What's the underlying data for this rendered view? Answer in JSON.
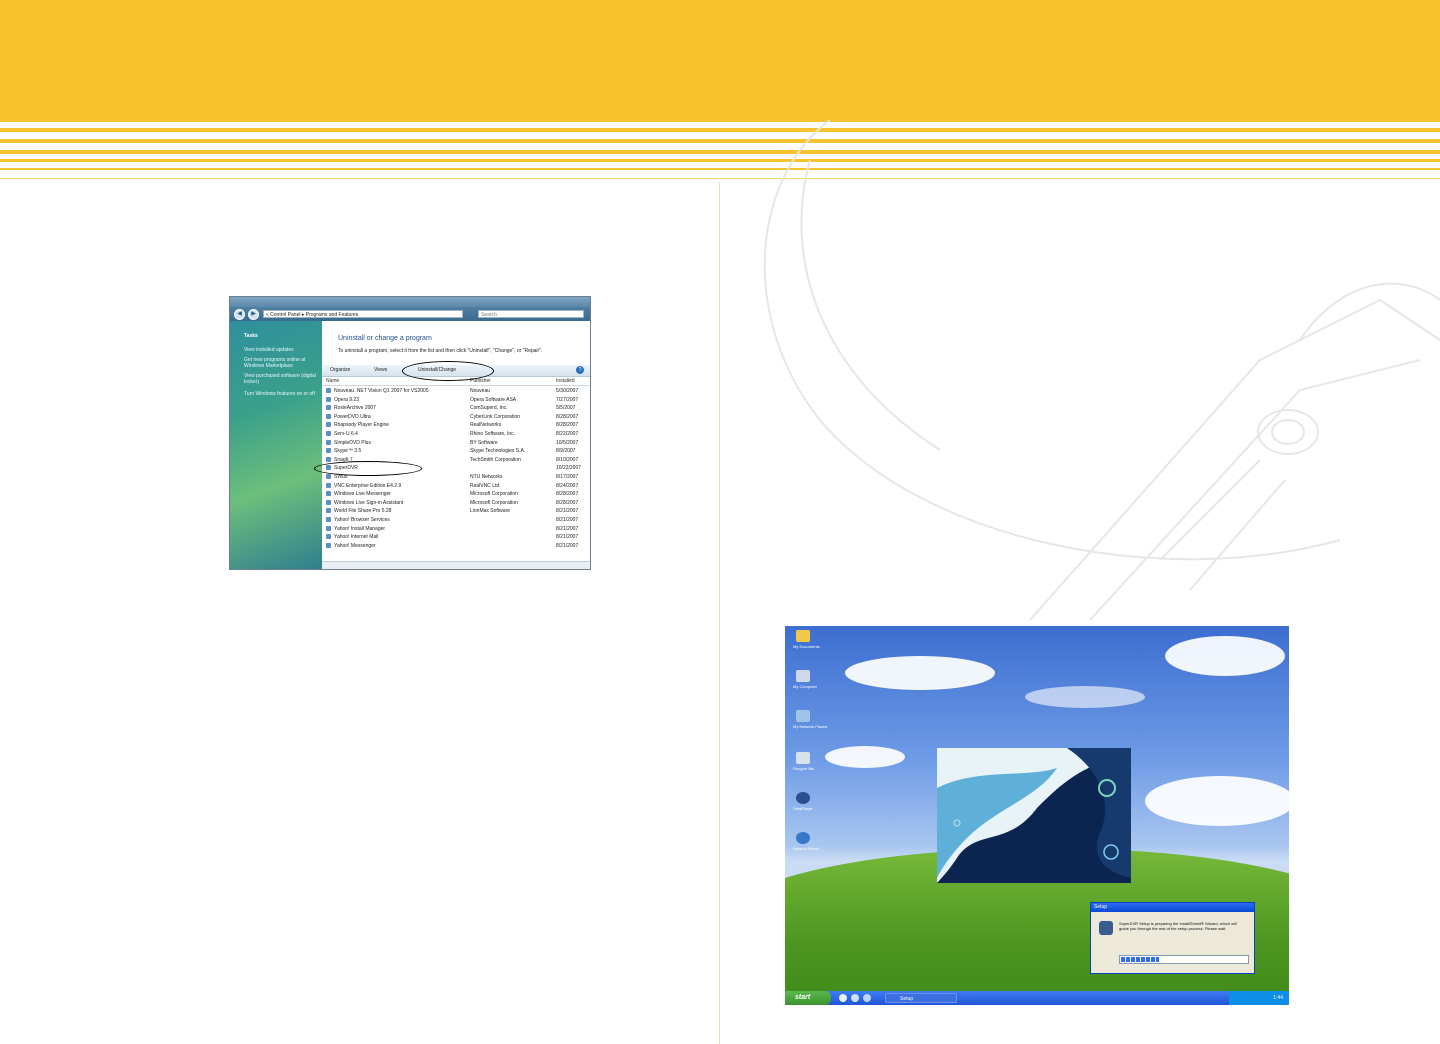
{
  "vista": {
    "address": "« Control Panel ▸ Programs and Features",
    "search_placeholder": "Search",
    "sidebar_heading": "Tasks",
    "sidebar_links": [
      "View installed updates",
      "Get new programs online at Windows Marketplace",
      "View purchased software (digital locker)",
      "Turn Windows features on or off"
    ],
    "heading": "Uninstall or change a program",
    "description": "To uninstall a program, select it from the list and then click \"Uninstall\", \"Change\", or \"Repair\".",
    "toolbar": {
      "organize": "Organize",
      "views": "Views",
      "uninstall_change": "Uninstall/Change"
    },
    "columns": {
      "name": "Name",
      "publisher": "Publisher",
      "installed": "Installed"
    },
    "rows": [
      {
        "name": "Nouveau .NET Vision Q1 2007 for VS2005",
        "publisher": "Nouveau",
        "date": "5/30/2007"
      },
      {
        "name": "Opera 9.23",
        "publisher": "Opera Software ASA",
        "date": "7/27/2007"
      },
      {
        "name": "RoxieArchive 2007",
        "publisher": "ComSuperd, Inc.",
        "date": "5/5/2007"
      },
      {
        "name": "PowerDVD Ultra",
        "publisher": "CyberLink Corporation",
        "date": "8/28/2007"
      },
      {
        "name": "Rhapsody Player Engine",
        "publisher": "RealNetworks",
        "date": "8/28/2007"
      },
      {
        "name": "Serv-U 6.4",
        "publisher": "Rhino Software, Inc.",
        "date": "8/22/2007"
      },
      {
        "name": "SimpleDVD Plus",
        "publisher": "BY Software",
        "date": "10/5/2007"
      },
      {
        "name": "Skype™ 3.5",
        "publisher": "Skype Technologies S.A.",
        "date": "8/9/2007"
      },
      {
        "name": "SnagIt 7",
        "publisher": "TechSmith Corporation",
        "date": "8/10/2007"
      },
      {
        "name": "SuperDVR",
        "publisher": "",
        "date": "10/22/2007"
      },
      {
        "name": "SWuo",
        "publisher": "NTU Networks",
        "date": "8/17/2007"
      },
      {
        "name": "VNC Enterprise Edition E4.2.9",
        "publisher": "RealVNC Ltd.",
        "date": "8/24/2007"
      },
      {
        "name": "Windows Live Messenger",
        "publisher": "Microsoft Corporation",
        "date": "8/28/2007"
      },
      {
        "name": "Windows Live Sign-in Assistant",
        "publisher": "Microsoft Corporation",
        "date": "8/28/2007"
      },
      {
        "name": "World File Share Pro 5.28",
        "publisher": "LionMax Software",
        "date": "8/21/2007"
      },
      {
        "name": "Yahoo! Browser Services",
        "publisher": "",
        "date": "8/21/2007"
      },
      {
        "name": "Yahoo! Install Manager",
        "publisher": "",
        "date": "8/21/2007"
      },
      {
        "name": "Yahoo! Internet Mail",
        "publisher": "",
        "date": "8/21/2007"
      },
      {
        "name": "Yahoo! Messenger",
        "publisher": "",
        "date": "8/21/2007"
      }
    ]
  },
  "xp": {
    "desktop_icons": [
      "My Documents",
      "My Computer",
      "My Network Places",
      "Recycle Bin",
      "RealPlayer",
      "Hotspot Shield"
    ],
    "dialog_title": "Setup",
    "dialog_message": "SuperDVR Setup is preparing the InstallShield® Wizard, which will guide you through the rest of the setup process. Please wait.",
    "progress": 0.3,
    "start_label": "start",
    "task_button": "Setup",
    "clock": "1:44"
  },
  "colors": {
    "band": "#f8c22d",
    "xp_taskbar": "#245edb"
  }
}
